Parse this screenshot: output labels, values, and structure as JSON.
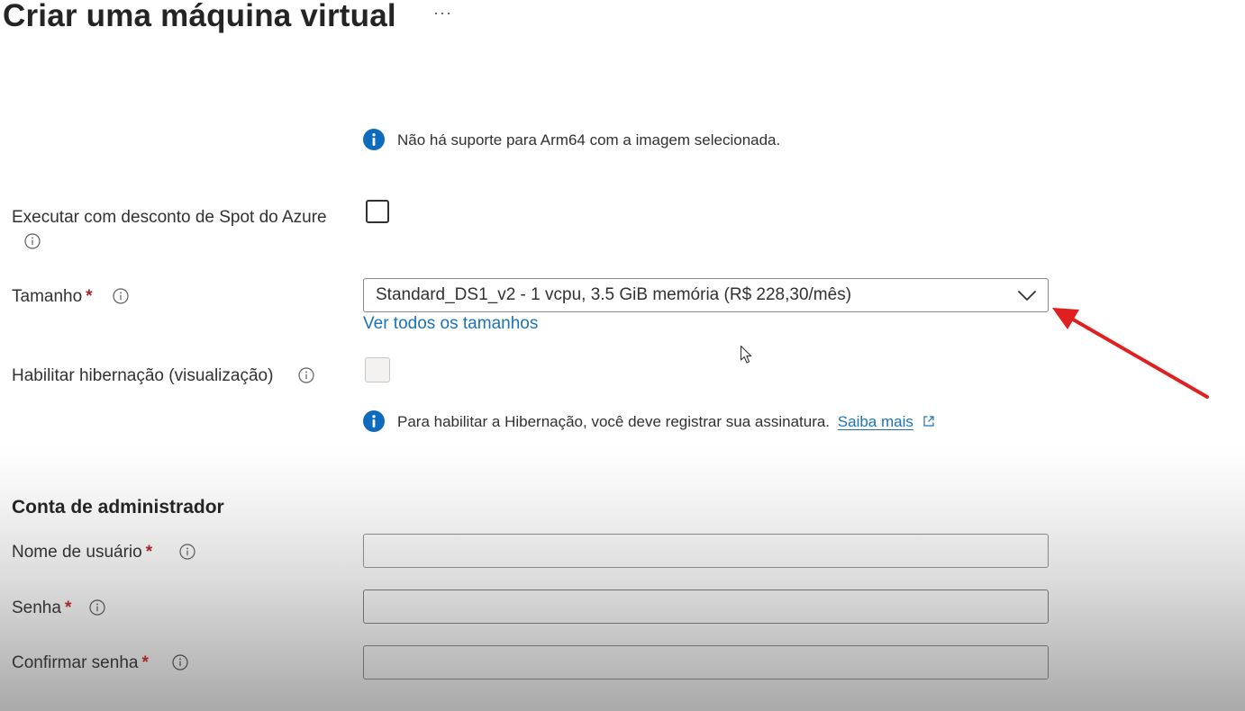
{
  "header": {
    "title": "Criar uma máquina virtual",
    "more_label": "···"
  },
  "notices": {
    "arm64": "Não há suporte para Arm64 com a imagem selecionada.",
    "hibernation": "Para habilitar a Hibernação, você deve registrar sua assinatura.",
    "hibernation_link": "Saiba mais"
  },
  "fields": {
    "spot": {
      "label": "Executar com desconto de Spot do Azure",
      "checked": false
    },
    "size": {
      "label": "Tamanho",
      "required_mark": "*",
      "value": "Standard_DS1_v2 - 1 vcpu, 3.5 GiB memória (R$ 228,30/mês)",
      "see_all_link": "Ver todos os tamanhos"
    },
    "hibernation": {
      "label": "Habilitar hibernação (visualização)",
      "checked": false,
      "disabled": true
    }
  },
  "admin": {
    "section_title": "Conta de administrador",
    "username": {
      "label": "Nome de usuário",
      "required_mark": "*",
      "value": ""
    },
    "password": {
      "label": "Senha",
      "required_mark": "*",
      "value": ""
    },
    "confirm_password": {
      "label": "Confirmar senha",
      "required_mark": "*",
      "value": ""
    }
  },
  "icons": {
    "info_filled": "info-circle-filled-icon",
    "info_outline": "info-circle-outline-icon",
    "external_link": "external-link-icon",
    "chevron": "chevron-down-icon",
    "cursor": "mouse-pointer-icon"
  },
  "colors": {
    "info_blue": "#0f6cbd",
    "link": "#1a73b8",
    "required": "#a4262c",
    "annotation_arrow": "#e02020"
  }
}
